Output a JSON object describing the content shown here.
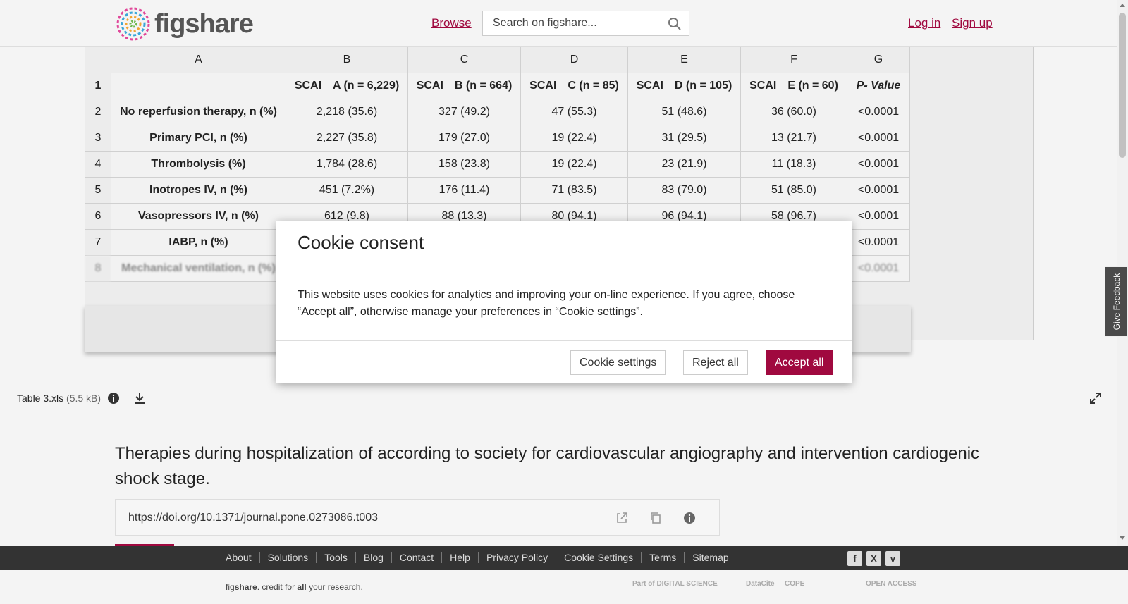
{
  "header": {
    "logo_text": "figshare",
    "browse": "Browse",
    "search_placeholder": "Search on figshare...",
    "login": "Log in",
    "signup": "Sign up"
  },
  "sheet": {
    "columns": [
      "",
      "A",
      "B",
      "C",
      "D",
      "E",
      "F",
      "G"
    ],
    "rows": [
      [
        "1",
        "",
        "SCAI A (n = 6,229)",
        "SCAI B (n = 664)",
        "SCAI C (n = 85)",
        "SCAI D (n = 105)",
        "SCAI E (n = 60)",
        "P- Value"
      ],
      [
        "2",
        "No reperfusion therapy, n (%)",
        "2,218 (35.6)",
        "327 (49.2)",
        "47 (55.3)",
        "51 (48.6)",
        "36 (60.0)",
        "<0.0001"
      ],
      [
        "3",
        "Primary PCI, n (%)",
        "2,227 (35.8)",
        "179 (27.0)",
        "19 (22.4)",
        "31 (29.5)",
        "13 (21.7)",
        "<0.0001"
      ],
      [
        "4",
        "Thrombolysis (%)",
        "1,784 (28.6)",
        "158 (23.8)",
        "19 (22.4)",
        "23 (21.9)",
        "11 (18.3)",
        "<0.0001"
      ],
      [
        "5",
        "Inotropes IV, n (%)",
        "451 (7.2%)",
        "176 (11.4)",
        "71 (83.5)",
        "83 (79.0)",
        "51 (85.0)",
        "<0.0001"
      ],
      [
        "6",
        "Vasopressors IV, n (%)",
        "612 (9.8)",
        "88 (13.3)",
        "80 (94.1)",
        "96 (94.1)",
        "58 (96.7)",
        "<0.0001"
      ],
      [
        "7",
        "IABP, n (%)",
        "",
        "",
        "",
        "",
        "",
        "<0.0001"
      ],
      [
        "8",
        "Mechanical ventilation, n (%)",
        "",
        "",
        "",
        "",
        "",
        "<0.0001"
      ]
    ]
  },
  "file": {
    "name": "Table 3.xls",
    "size": "(5.5 kB)"
  },
  "item": {
    "title": "Therapies during hospitalization of according to society for cardiovascular angiography and intervention cardiogenic shock stage.",
    "doi": "https://doi.org/10.1371/journal.pone.0273086.t003"
  },
  "footer": {
    "links": [
      "About",
      "Solutions",
      "Tools",
      "Blog",
      "Contact",
      "Help",
      "Privacy Policy",
      "Cookie Settings",
      "Terms",
      "Sitemap"
    ],
    "credit_prefix": "fig",
    "credit_brand": "share",
    "credit_mid": ". credit for ",
    "credit_all": "all",
    "credit_suffix": " your research.",
    "partners": [
      "Part of DIGITAL SCIENCE",
      "DataCite",
      "COPE",
      "OPEN ACCESS"
    ],
    "social": [
      "f",
      "X",
      "v"
    ]
  },
  "feedback": "Give Feedback",
  "cookie": {
    "title": "Cookie consent",
    "body": "This website uses cookies for analytics and improving your on-line experience. If you agree, choose “Accept all”, otherwise manage your preferences in “Cookie settings”.",
    "settings": "Cookie settings",
    "reject": "Reject all",
    "accept": "Accept all"
  },
  "colors": {
    "accent": "#a0093f",
    "footer_bg": "#333333"
  }
}
